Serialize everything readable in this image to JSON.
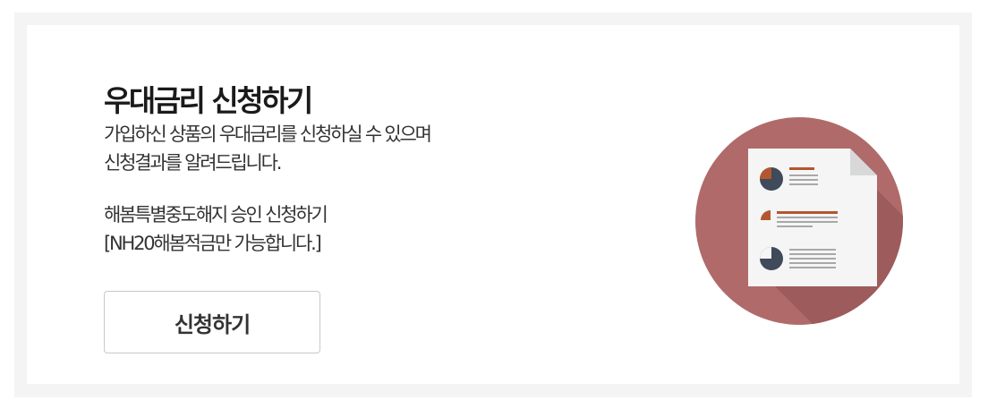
{
  "card": {
    "title": "우대금리 신청하기",
    "description_lines": [
      "가입하신 상품의 우대금리를 신청하실 수 있으며",
      "신청결과를 알려드립니다."
    ],
    "notice_lines": [
      "해봄특별중도해지 승인 신청하기",
      "[NH20해봄적금만 가능합니다.]"
    ],
    "apply_button_label": "신청하기"
  },
  "illustration": {
    "icon": "document-report-icon",
    "circle_color": "#b06a6a",
    "shadow_color": "#9a5858",
    "accent_color": "#b4562f",
    "chart_color": "#3f4a5a"
  }
}
